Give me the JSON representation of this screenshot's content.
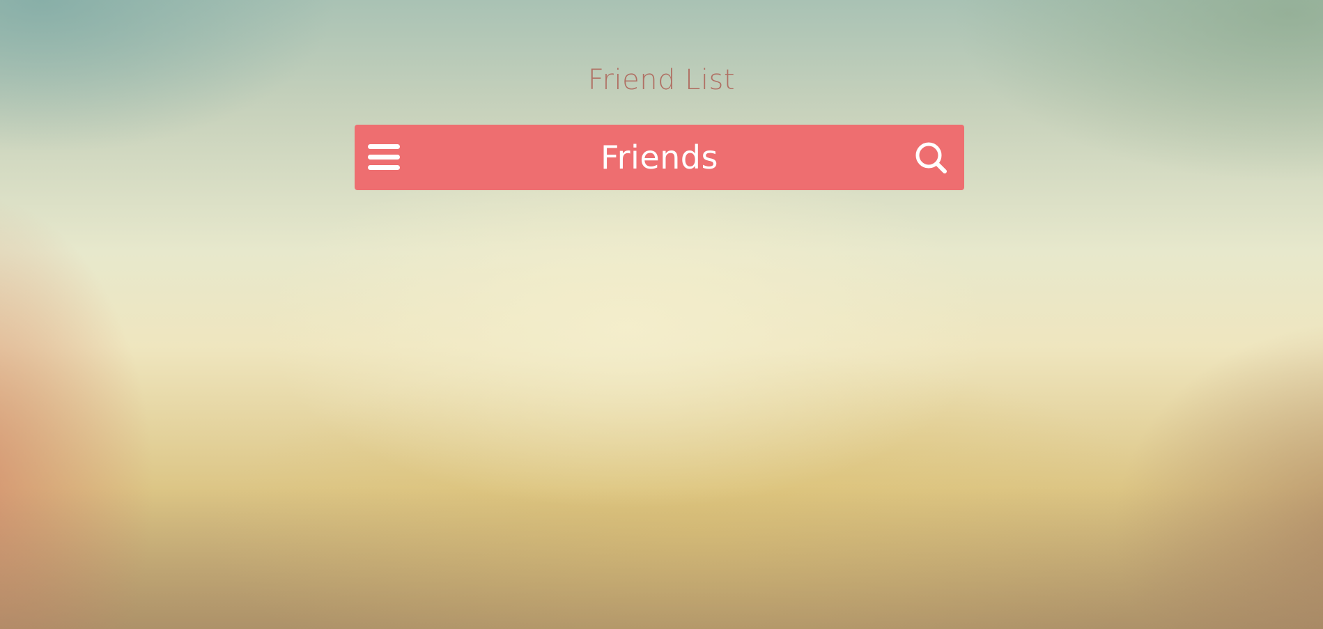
{
  "page": {
    "title": "Friend List"
  },
  "appbar": {
    "title": "Friends",
    "background_color": "#ee6e70",
    "menu_icon": "hamburger-menu-icon",
    "search_icon": "search-icon"
  }
}
